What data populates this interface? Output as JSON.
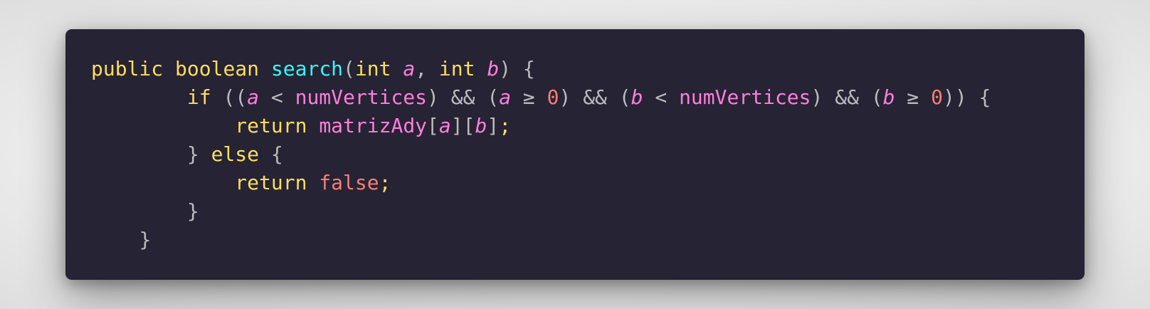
{
  "code": {
    "keywords": {
      "public": "public",
      "boolean": "boolean",
      "int": "int",
      "if": "if",
      "return": "return",
      "else": "else"
    },
    "function_name": "search",
    "params": {
      "a": "a",
      "b": "b"
    },
    "identifiers": {
      "num_vertices": "numVertices",
      "matriz_ady": "matrizAdy"
    },
    "literals": {
      "zero": "0",
      "false": "false"
    },
    "operators": {
      "lt": "<",
      "gte": "≥",
      "and": "&&"
    },
    "colors": {
      "background": "#262335",
      "keyword": "#fede5d",
      "function": "#36f9f6",
      "identifier": "#ff7edb",
      "number": "#f97e72",
      "punctuation": "#bbbbbb"
    }
  }
}
